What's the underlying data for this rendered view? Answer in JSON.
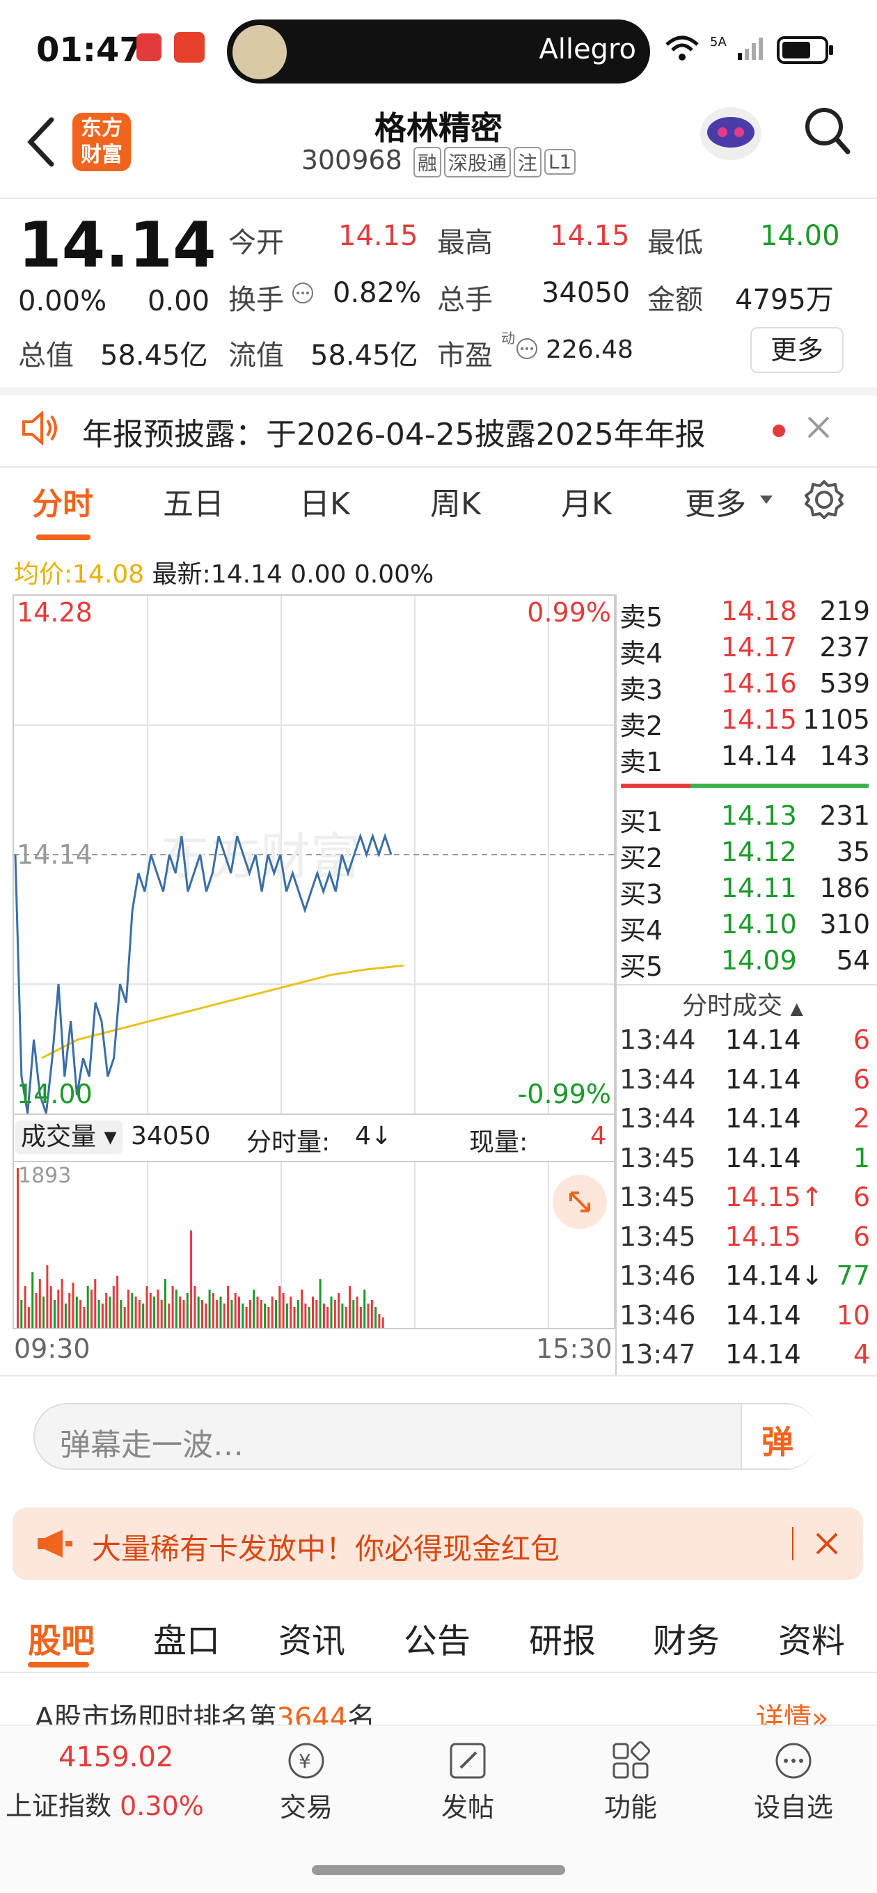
{
  "status_bar": {
    "time": "01:47",
    "media_label": "Allegro"
  },
  "header": {
    "logo_text": "东方财富",
    "stock_name": "格林精密",
    "stock_code": "300968",
    "tags": [
      "融",
      "深股通",
      "注",
      "L1"
    ]
  },
  "quote": {
    "price": "14.14",
    "change_pct": "0.00%",
    "change": "0.00",
    "open_label": "今开",
    "open": "14.15",
    "high_label": "最高",
    "high": "14.15",
    "low_label": "最低",
    "low": "14.00",
    "turnover_label": "换手",
    "turnover": "0.82%",
    "volume_label": "总手",
    "volume": "34050",
    "amount_label": "金额",
    "amount": "4795万",
    "mktcap_label": "总值",
    "mktcap": "58.45亿",
    "float_label": "流值",
    "float_cap": "58.45亿",
    "pe_label": "市盈",
    "pe_sup": "动",
    "pe": "226.48",
    "more_label": "更多"
  },
  "notice": {
    "text": "年报预披露：于2026-04-25披露2025年年报"
  },
  "chart_tabs": [
    "分时",
    "五日",
    "日K",
    "周K",
    "月K",
    "更多"
  ],
  "intraday": {
    "avg_label": "均价:",
    "avg": "14.08",
    "latest_label": "最新:",
    "latest": "14.14 0.00 0.00%",
    "top_price": "14.28",
    "top_pct": "0.99%",
    "bottom_price": "14.00",
    "bottom_pct": "-0.99%",
    "ref_price": "14.14",
    "watermark": "东方财富",
    "vol_selector": "成交量",
    "vol_total": "34050",
    "minute_vol_label": "分时量:",
    "minute_vol": "4↓",
    "cur_vol_label": "现量:",
    "cur_vol": "4",
    "vol_max": "1893",
    "start_time": "09:30",
    "end_time": "15:30"
  },
  "chart_data": {
    "type": "line",
    "x_range": [
      "09:30",
      "15:30"
    ],
    "ylim": [
      14.0,
      14.28
    ],
    "series": [
      {
        "values": [
          14.14,
          14.02,
          14.0,
          14.04,
          14.01,
          14.0,
          14.03,
          14.07,
          14.02,
          14.05,
          14.01,
          14.03,
          14.02,
          14.06,
          14.05,
          14.02,
          14.03,
          14.07,
          14.06,
          14.11,
          14.13,
          14.12,
          14.14,
          14.13,
          14.12,
          14.14,
          14.13,
          14.15,
          14.12,
          14.13,
          14.14,
          14.12,
          14.13,
          14.15,
          14.14,
          14.13,
          14.15,
          14.14,
          14.13,
          14.14,
          14.12,
          14.14,
          14.13,
          14.14,
          14.12,
          14.13,
          14.12,
          14.11,
          14.12,
          14.13,
          14.12,
          14.13,
          14.12,
          14.14,
          14.13,
          14.14,
          14.15,
          14.14,
          14.15,
          14.14,
          14.15,
          14.14
        ]
      },
      {
        "values": [
          14.03,
          14.04,
          14.045,
          14.05,
          14.055,
          14.06,
          14.065,
          14.07,
          14.075,
          14.078,
          14.08
        ]
      }
    ]
  },
  "orderbook": {
    "asks": [
      {
        "label": "卖5",
        "price": "14.18",
        "qty": "219"
      },
      {
        "label": "卖4",
        "price": "14.17",
        "qty": "237"
      },
      {
        "label": "卖3",
        "price": "14.16",
        "qty": "539"
      },
      {
        "label": "卖2",
        "price": "14.15",
        "qty": "1105"
      },
      {
        "label": "卖1",
        "price": "14.14",
        "qty": "143"
      }
    ],
    "bids": [
      {
        "label": "买1",
        "price": "14.13",
        "qty": "231"
      },
      {
        "label": "买2",
        "price": "14.12",
        "qty": "35"
      },
      {
        "label": "买3",
        "price": "14.11",
        "qty": "186"
      },
      {
        "label": "买4",
        "price": "14.10",
        "qty": "310"
      },
      {
        "label": "买5",
        "price": "14.09",
        "qty": "54"
      }
    ],
    "trades_title": "分时成交",
    "trades": [
      {
        "time": "13:44",
        "price": "14.14",
        "qty": "6",
        "pcolor": "#222",
        "qcolor": "#e33b3b"
      },
      {
        "time": "13:44",
        "price": "14.14",
        "qty": "6",
        "pcolor": "#222",
        "qcolor": "#e33b3b"
      },
      {
        "time": "13:44",
        "price": "14.14",
        "qty": "2",
        "pcolor": "#222",
        "qcolor": "#e33b3b"
      },
      {
        "time": "13:45",
        "price": "14.14",
        "qty": "1",
        "pcolor": "#222",
        "qcolor": "#1a9a2a"
      },
      {
        "time": "13:45",
        "price": "14.15↑",
        "qty": "6",
        "pcolor": "#e33b3b",
        "qcolor": "#e33b3b"
      },
      {
        "time": "13:45",
        "price": "14.15",
        "qty": "6",
        "pcolor": "#e33b3b",
        "qcolor": "#e33b3b"
      },
      {
        "time": "13:46",
        "price": "14.14↓",
        "qty": "77",
        "pcolor": "#222",
        "qcolor": "#1a9a2a"
      },
      {
        "time": "13:46",
        "price": "14.14",
        "qty": "10",
        "pcolor": "#222",
        "qcolor": "#e33b3b"
      },
      {
        "time": "13:47",
        "price": "14.14",
        "qty": "4",
        "pcolor": "#222",
        "qcolor": "#e33b3b"
      }
    ]
  },
  "danmu": {
    "placeholder": "弹幕走一波…",
    "button": "弹"
  },
  "promo": {
    "text": "大量稀有卡发放中！你必得现金红包"
  },
  "sub_tabs": [
    "股吧",
    "盘口",
    "资讯",
    "公告",
    "研报",
    "财务",
    "资料"
  ],
  "ranking": {
    "prefix": "A股市场即时排名第",
    "rank": "3644",
    "suffix": "名",
    "detail": "详情"
  },
  "bottom_bar": {
    "index_value": "4159.02",
    "index_name": "上证指数",
    "index_change": "0.30%",
    "items": [
      "交易",
      "发帖",
      "功能",
      "设自选"
    ]
  },
  "colors": {
    "up": "#e33b3b",
    "down": "#1a9a2a",
    "accent": "#f0641e",
    "avg_line": "#e8c21a",
    "price_line": "#3a6ea5"
  }
}
